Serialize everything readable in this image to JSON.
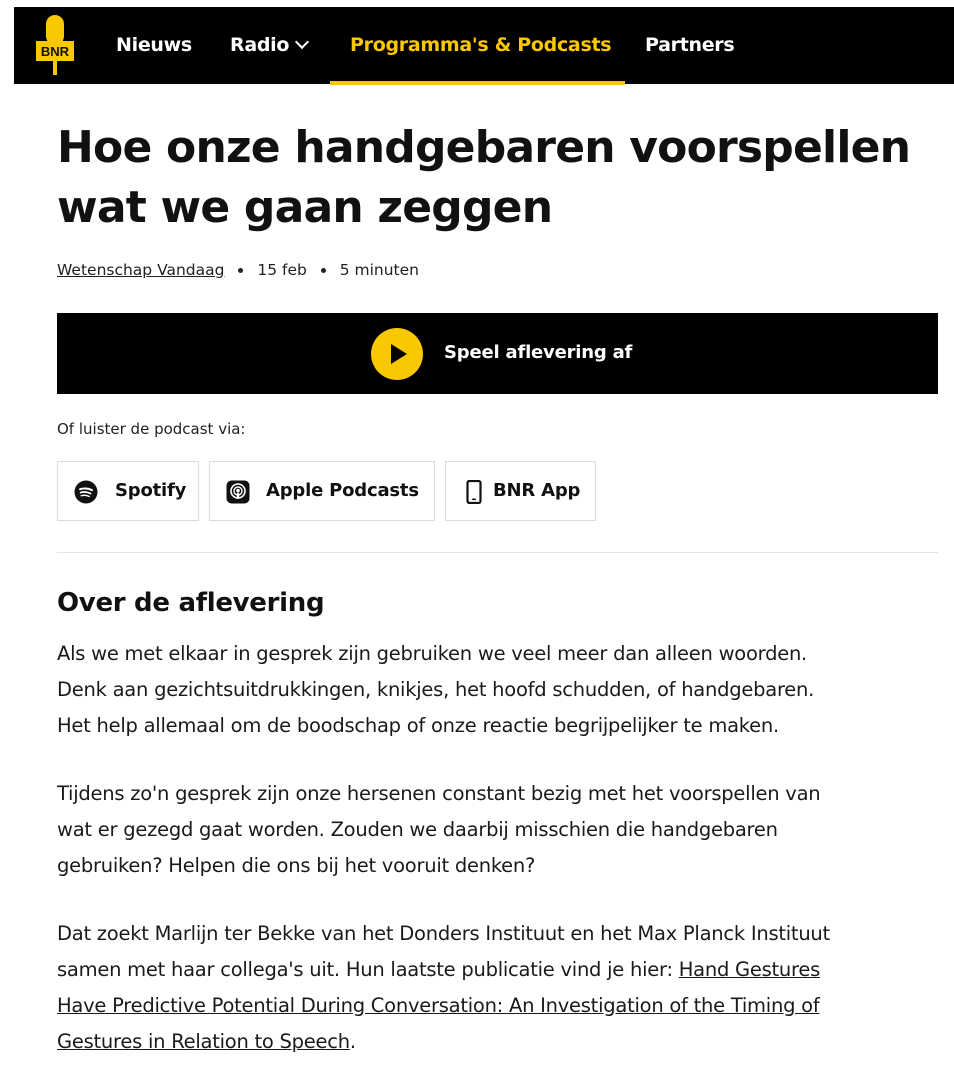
{
  "nav": {
    "logo_text": "BNR",
    "items": [
      {
        "label": "Nieuws"
      },
      {
        "label": "Radio"
      },
      {
        "label": "Programma's & Podcasts"
      },
      {
        "label": "Partners"
      }
    ],
    "active_index": 2
  },
  "article": {
    "title_line1": "Hoe onze handgebaren voorspellen",
    "title_line2": "wat we gaan zeggen",
    "program": "Wetenschap Vandaag",
    "date": "15 feb",
    "duration": "5 minuten"
  },
  "player": {
    "play_label": "Speel aflevering af"
  },
  "listen": {
    "intro": "Of luister de podcast via:",
    "services": [
      {
        "label": "Spotify",
        "icon": "spotify-icon"
      },
      {
        "label": "Apple Podcasts",
        "icon": "apple-podcasts-icon"
      },
      {
        "label": "BNR App",
        "icon": "phone-icon"
      }
    ]
  },
  "about": {
    "heading": "Over de aflevering",
    "p1_lines": [
      "Als we met elkaar in gesprek zijn gebruiken we veel meer dan alleen woorden.",
      "Denk aan gezichtsuitdrukkingen, knikjes, het hoofd schudden, of handgebaren.",
      "Het help allemaal om de boodschap of onze reactie begrijpelijker te maken."
    ],
    "p2_lines": [
      "Tijdens zo'n gesprek zijn onze hersenen constant bezig met het voorspellen van",
      "wat er gezegd gaat worden. Zouden we daarbij misschien die handgebaren",
      "gebruiken? Helpen die ons bij het vooruit denken?"
    ],
    "p3_line1": "Dat zoekt Marlijn ter Bekke van het Donders Instituut en het Max Planck Instituut",
    "p3_line2_text": "samen met haar collega's uit. Hun laatste publicatie vind je hier: ",
    "p3_link_line1": "Hand Gestures",
    "p3_link_line2": "Have Predictive Potential During Conversation: An Investigation of the Timing of",
    "p3_link_line3": "Gestures in Relation to Speech",
    "p3_end": "."
  },
  "colors": {
    "accent": "#f9c800",
    "nav_bg": "#000000",
    "text": "#111111"
  }
}
